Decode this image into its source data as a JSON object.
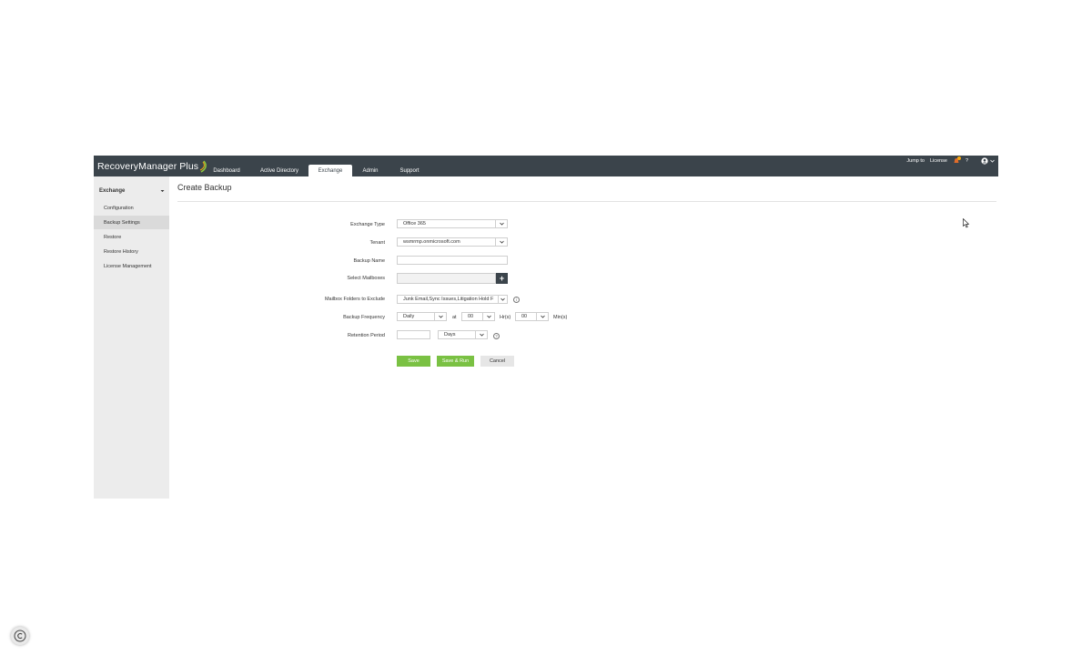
{
  "app": {
    "brand": "RecoveryManager",
    "brand_suffix": "Plus"
  },
  "nav": {
    "tabs": [
      {
        "label": "Dashboard"
      },
      {
        "label": "Active Directory"
      },
      {
        "label": "Exchange"
      },
      {
        "label": "Admin"
      },
      {
        "label": "Support"
      }
    ],
    "active": "Exchange"
  },
  "topbar": {
    "jump_to": "Jump to",
    "license": "License"
  },
  "sidebar": {
    "header": "Exchange",
    "items": [
      {
        "label": "Configuration"
      },
      {
        "label": "Backup Settings"
      },
      {
        "label": "Restore"
      },
      {
        "label": "Restore History"
      },
      {
        "label": "License Management"
      }
    ],
    "active": "Backup Settings"
  },
  "page": {
    "title": "Create Backup"
  },
  "form": {
    "exchange_type": {
      "label": "Exchange Type",
      "value": "Office 365"
    },
    "tenant": {
      "label": "Tenant",
      "value": "wsmrmp.onmicrosoft.com"
    },
    "backup_name": {
      "label": "Backup Name",
      "value": ""
    },
    "select_mailboxes": {
      "label": "Select Mailboxes",
      "value": ""
    },
    "mailbox_folders": {
      "label": "Mailbox Folders to Exclude",
      "value": "Junk Email,Sync Issues,Litigation Hold F"
    },
    "backup_frequency": {
      "label": "Backup Frequency",
      "frequency": "Daily",
      "at": "at",
      "hours": "00",
      "hours_unit": "Hr(s)",
      "minutes": "00",
      "minutes_unit": "Min(s)"
    },
    "retention_period": {
      "label": "Retention Period",
      "value": "",
      "unit": "Days"
    }
  },
  "buttons": {
    "save": "Save",
    "save_run": "Save & Run",
    "cancel": "Cancel"
  },
  "colors": {
    "topbar": "#3b444b",
    "accent_green": "#7ac143",
    "sidebar_bg": "#ececec"
  }
}
